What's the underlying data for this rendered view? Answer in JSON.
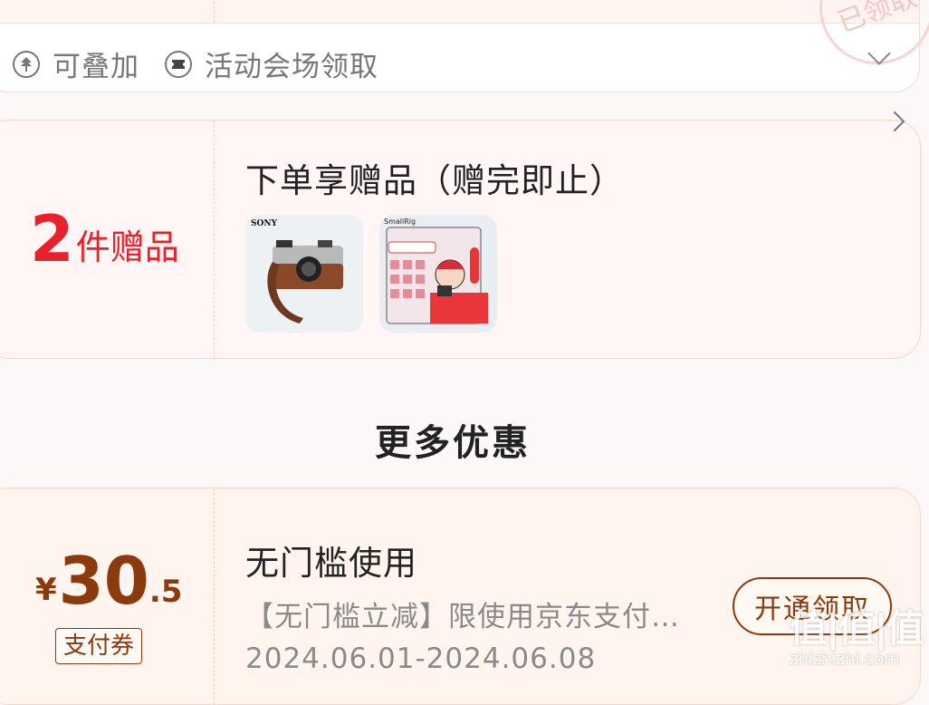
{
  "top_card": {
    "stamp_text": "已领取",
    "tags": [
      {
        "icon": "stack-icon",
        "label": "可叠加"
      },
      {
        "icon": "ticket-icon",
        "label": "活动会场领取"
      }
    ]
  },
  "gift_card": {
    "count": "2",
    "count_unit": "件赠品",
    "title": "下单享赠品（赠完即止）",
    "items": [
      {
        "name": "SONY camera leather case",
        "brand": "SONY"
      },
      {
        "name": "SmallRig gift illustration",
        "brand": "SmallRig"
      }
    ]
  },
  "section": {
    "more_title": "更多优惠"
  },
  "coupon": {
    "currency": "¥",
    "amount_int": "30",
    "amount_dec": ".5",
    "badge": "支付券",
    "title": "无门槛使用",
    "description": "【无门槛立减】限使用京东支付…",
    "date_range": "2024.06.01-2024.06.08",
    "button_label": "开通领取"
  },
  "watermark": {
    "logo": "值|值|值",
    "url": "zhizhizhi.com"
  },
  "colors": {
    "accent_red": "#e8222d",
    "coupon_brown": "#8a3a0c",
    "gift_card_bg": "#fff6f5",
    "coupon_card_bg": "#fff5ee"
  }
}
